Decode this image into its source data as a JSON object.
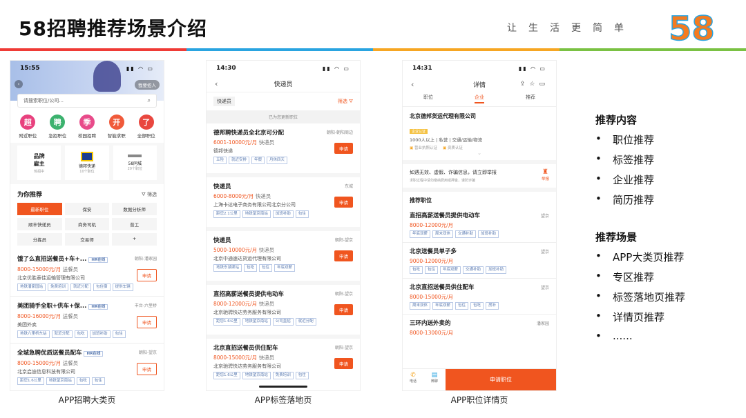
{
  "slide": {
    "title": "58招聘推荐场景介绍",
    "slogan": "让生活更简单",
    "logo_text": "58",
    "stripe_colors": [
      "#ef3b36",
      "#2aa4e0",
      "#f6a623",
      "#7ac143"
    ]
  },
  "captions": [
    "APP招聘大类页",
    "APP标签落地页",
    "APP职位详情页"
  ],
  "phone1": {
    "time": "15:55",
    "search_placeholder": "请搜索职位/公司...",
    "post_btn": "我要招人",
    "categories": [
      {
        "glyph": "超",
        "label": "附近职位",
        "color": "#e8417e"
      },
      {
        "glyph": "聘",
        "label": "急招职位",
        "color": "#3cb26e"
      },
      {
        "glyph": "季",
        "label": "校园招聘",
        "color": "#e84b8a"
      },
      {
        "glyph": "开",
        "label": "智能求职",
        "color": "#f05a3a"
      },
      {
        "glyph": "了",
        "label": "全部职位",
        "color": "#e9473f"
      }
    ],
    "brands": [
      {
        "name": "品牌\n雇主",
        "sub": "热招中"
      },
      {
        "name": "德邦快递",
        "sub": "10个职位"
      },
      {
        "name": "58同城",
        "sub": "20个职位"
      }
    ],
    "section_title": "为你推荐",
    "filter_label": "筛选",
    "chips": [
      "最新职位",
      "保安",
      "数据分析师",
      "顺丰快递员",
      "商务司机",
      "普工",
      "分拣员",
      "交易师",
      "+"
    ],
    "jobs": [
      {
        "title": "饿了么直招送餐员+车+...",
        "badge": "HR在线",
        "loc": "朝阳-潘家园",
        "salary": "8000-15000元/月",
        "role": "送餐员",
        "company": "北京优胜泰佳运输管理有限公司",
        "tags": [
          "地铁潘家园站",
          "免费培训",
          "就近分配",
          "包住宿",
          "提供车辆"
        ],
        "apply": "申请"
      },
      {
        "title": "美团骑手全职+供车+保...",
        "badge": "HR在线",
        "loc": "丰台-六里桥",
        "salary": "8000-16000元/月",
        "role": "送餐员",
        "company": "美团外卖",
        "tags": [
          "地铁六里桥东站",
          "就近分配",
          "包吃",
          "加班补助",
          "包住"
        ],
        "apply": "申请"
      },
      {
        "title": "全城急聘优质送餐员配车",
        "badge": "HR在线",
        "loc": "朝阳-望京",
        "salary": "8000-15000元/月",
        "role": "送餐员",
        "company": "北京启迪信息科技有限公司",
        "tags": [
          "距您1.6公里",
          "地铁望京南站",
          "包吃",
          "包住"
        ],
        "apply": "申请"
      }
    ]
  },
  "phone2": {
    "time": "14:30",
    "nav_title": "快递员",
    "filter_tag": "快递员",
    "filter_btn": "筛选",
    "notice": "已为您更新职位",
    "jobs": [
      {
        "title": "德邦聘快递员全北京可分配",
        "loc": "朝阳-朝阳周边",
        "salary": "6001-10000元/月",
        "role": "快递员",
        "company": "德邦快递",
        "tags": [
          "五险",
          "就近安排",
          "年假",
          "月休四天"
        ],
        "apply": "申请"
      },
      {
        "title": "快递员",
        "loc": "东城",
        "salary": "6000-8000元/月",
        "role": "快递员",
        "company": "上海卡达电子商务有限公司北京分公司",
        "tags": [
          "距您2.1公里",
          "地铁望京南站",
          "加班补助",
          "包住"
        ],
        "apply": "申请"
      },
      {
        "title": "快递员",
        "loc": "朝阳-望京",
        "salary": "5000-10000元/月",
        "role": "快递员",
        "company": "北京中通速达货运代理有限公司",
        "tags": [
          "地铁东湖渠站",
          "包吃",
          "包住",
          "年底双薪"
        ],
        "apply": "申请"
      },
      {
        "title": "直招高薪送餐员提供电动车",
        "loc": "朝阳-望京",
        "salary": "8000-12000元/月",
        "role": "快递员",
        "company": "北京驰骋快达劳务服务有限公司",
        "tags": [
          "距您1.6公里",
          "地铁望京南站",
          "公司直招",
          "就近分配"
        ],
        "apply": "申请"
      },
      {
        "title": "北京直招送餐员供住配车",
        "loc": "朝阳-望京",
        "salary": "8000-15000元/月",
        "role": "快递员",
        "company": "北京驰骋快达劳务服务有限公司",
        "tags": [
          "距您1.6公里",
          "地铁望京南站",
          "免费培训",
          "包住"
        ],
        "apply": "申请"
      }
    ]
  },
  "phone3": {
    "time": "14:31",
    "nav_title": "详情",
    "tabs": [
      "职位",
      "企业",
      "推荐"
    ],
    "active_tab": 1,
    "company": "北京德邦货运代理有限公司",
    "company_badge": "企业认证",
    "company_meta": "1000人以上 | 私营 | 交通/运输/物流",
    "cert1": "营业执照认证",
    "cert2": "资质认证",
    "warn": "如遇无效、虚假、诈骗信息，请立即举报",
    "warn_sub": "求职过程中请勿缴纳费用或押金，谨防诈骗",
    "report": "举报",
    "rec_title": "推荐职位",
    "jobs": [
      {
        "title": "直招高薪送餐员提供电动车",
        "loc": "望京",
        "salary": "8000-12000元/月",
        "tags": [
          "年底双薪",
          "周末双休",
          "交通补助",
          "加班补助"
        ]
      },
      {
        "title": "北京送餐员单子多",
        "loc": "望京",
        "salary": "9000-12000元/月",
        "tags": [
          "包吃",
          "包住",
          "年底双薪",
          "交通补助",
          "加班补助"
        ]
      },
      {
        "title": "北京直招送餐员供住配车",
        "loc": "望京",
        "salary": "8000-15000元/月",
        "tags": [
          "周末双休",
          "年底双薪",
          "包住",
          "包吃",
          "房补"
        ]
      },
      {
        "title": "三环内送外卖的",
        "loc": "潘家园",
        "salary": "8000-13000元/月",
        "tags": []
      }
    ],
    "bottom_phone": "电话",
    "bottom_chat": "微聊",
    "apply_btn": "申请职位"
  },
  "right": {
    "section1_title": "推荐内容",
    "section1_items": [
      "职位推荐",
      "标签推荐",
      "企业推荐",
      "简历推荐"
    ],
    "section2_title": "推荐场景",
    "section2_items": [
      "APP大类页推荐",
      "专区推荐",
      "标签落地页推荐",
      "详情页推荐",
      "......"
    ]
  }
}
